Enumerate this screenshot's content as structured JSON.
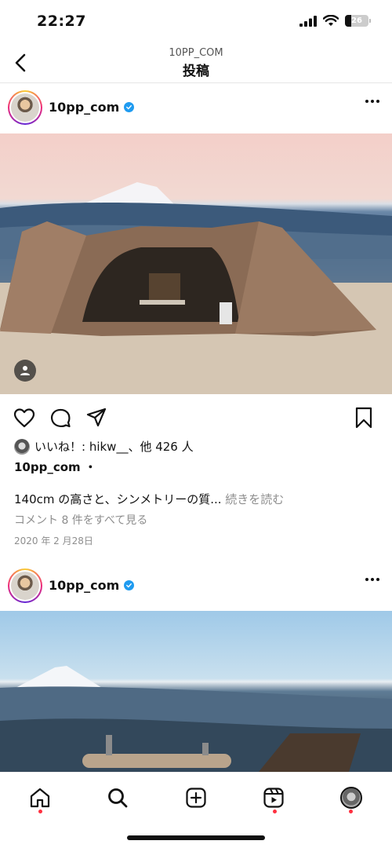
{
  "status_bar": {
    "time": "22:27",
    "battery": "26",
    "battery_level": 0.26
  },
  "header": {
    "subtitle": "10PP_COM",
    "title": "投稿"
  },
  "posts": [
    {
      "username": "10pp_com",
      "likes_text": "いいね！: hikw__、他 426 人",
      "caption_username": "10pp_com ・",
      "caption": "140cm の高さと、シンメトリーの質... ",
      "caption_more": "続きを読む",
      "comments_link": "コメント 8 件をすべて見る",
      "date": "2020 年 2 月28日"
    },
    {
      "username": "10pp_com"
    }
  ],
  "icons": {
    "back": "chevron-left-icon",
    "verified": "verified-badge-icon",
    "more": "more-horizontal-icon",
    "like": "heart-icon",
    "comment": "comment-icon",
    "share": "send-icon",
    "save": "bookmark-icon",
    "tagged": "user-tag-icon",
    "home": "home-icon",
    "search": "search-icon",
    "create": "plus-square-icon",
    "reels": "reels-icon",
    "profile": "profile-avatar"
  },
  "colors": {
    "verified": "#1f9bf0",
    "notification_dot": "#ff3040",
    "muted_text": "#8e8e8e"
  }
}
